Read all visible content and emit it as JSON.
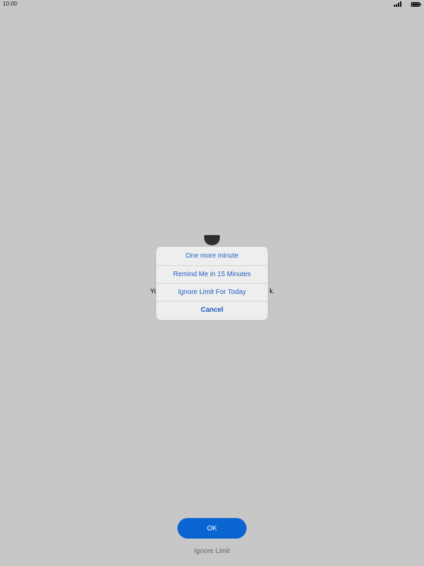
{
  "status_bar": {
    "time": "10:00",
    "signal_icon": "cellular-signal-icon",
    "battery_icon": "battery-icon"
  },
  "background": {
    "app_icon": "app-icon",
    "message_left": "Yo",
    "message_right": "k."
  },
  "action_sheet": {
    "items": [
      {
        "label": "One more minute"
      },
      {
        "label": "Remind Me in 15 Minutes"
      },
      {
        "label": "Ignore Limit For Today"
      }
    ],
    "cancel_label": "Cancel"
  },
  "footer": {
    "ok_label": "OK",
    "ignore_label": "Ignore Limit"
  },
  "colors": {
    "background": "#c7c7c7",
    "accent": "#0a64d2",
    "sheet_text": "#1f5fc4"
  }
}
